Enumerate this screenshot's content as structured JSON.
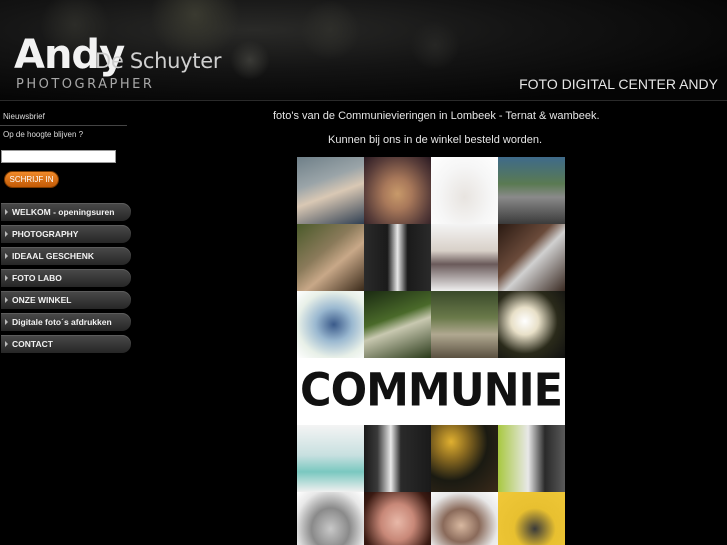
{
  "header": {
    "logo_first": "Andy",
    "logo_rest": "De Schuyter",
    "logo_sub": "PHOTOGRAPHER",
    "title": "FOTO DIGITAL CENTER ANDY"
  },
  "newsletter": {
    "title": "Nieuwsbrief",
    "subtitle": "Op de hoogte blijven ?",
    "input_value": "",
    "button_label": "SCHRIJF IN"
  },
  "menu": {
    "items": [
      {
        "label": "WELKOM - openingsuren"
      },
      {
        "label": "PHOTOGRAPHY"
      },
      {
        "label": "IDEAAL GESCHENK"
      },
      {
        "label": "FOTO LABO"
      },
      {
        "label": "ONZE WINKEL"
      },
      {
        "label": "Digitale foto´s afdrukken"
      },
      {
        "label": "CONTACT"
      }
    ]
  },
  "main": {
    "line1": "foto's van de Communievieringen in Lombeek - Ternat & wambeek.",
    "line2": "Kunnen bij ons in de winkel besteld worden.",
    "poster_title": "COMMUNIE"
  },
  "colors": {
    "background": "#000000",
    "accent": "#e07a1a",
    "menu_bg": "#333333"
  }
}
